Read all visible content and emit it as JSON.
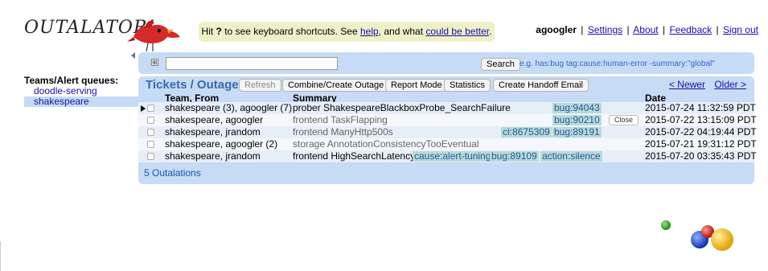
{
  "app": {
    "logo_text": "OUTALATOR!",
    "hint": {
      "prefix": "Hit ",
      "key": "?",
      "middle": " to see keyboard shortcuts. See ",
      "help_link": "help",
      "and": ", and what ",
      "better_link": "could be better",
      "suffix": "."
    }
  },
  "userbar": {
    "username": "agoogler",
    "links": [
      "Settings",
      "About",
      "Feedback",
      "Sign out"
    ]
  },
  "sidebar": {
    "title": "Teams/Alert queues:",
    "items": [
      {
        "label": "doodle-serving",
        "selected": false
      },
      {
        "label": "shakespeare",
        "selected": true
      }
    ]
  },
  "search": {
    "expand_symbol": "⊞",
    "value": "",
    "button_label": "Search",
    "example": "e.g. has:bug tag:cause:human-error -summary:\"global\""
  },
  "tickets": {
    "title": "Tickets / Outages",
    "buttons": {
      "refresh": "Refresh",
      "combine": "Combine/Create Outage",
      "report": "Report Mode",
      "statistics": "Statistics",
      "handoff": "Create Handoff Email"
    },
    "pager": {
      "newer": "< Newer",
      "older": "Older >"
    },
    "columns": {
      "team": "Team, From",
      "summary": "Summary",
      "date": "Date"
    },
    "rows": [
      {
        "team": "shakespeare (3), agoogler (7)",
        "summary": "prober ShakespeareBlackboxProbe_SearchFailure",
        "muted": false,
        "tags": [
          {
            "text": "bug:94043"
          }
        ],
        "close": "",
        "date": "2015-07-24 11:32:59 PDT",
        "cursor": true
      },
      {
        "team": "shakespeare, agoogler",
        "summary": "frontend TaskFlapping",
        "muted": true,
        "tags": [
          {
            "text": "bug:90210"
          }
        ],
        "close": "Close",
        "date": "2015-07-22 13:15:09 PDT",
        "cursor": false
      },
      {
        "team": "shakespeare, jrandom",
        "summary": "frontend ManyHttp500s",
        "muted": true,
        "tags": [
          {
            "text": "cl:8675309"
          },
          {
            "text": "bug:89191"
          }
        ],
        "close": "",
        "date": "2015-07-22 04:19:44 PDT",
        "cursor": false
      },
      {
        "team": "shakespeare, agoogler (2)",
        "summary": "storage AnnotationConsistencyTooEventual",
        "muted": true,
        "tags": [],
        "close": "",
        "date": "2015-07-21 19:31:12 PDT",
        "cursor": false
      },
      {
        "team": "shakespeare, jrandom",
        "summary": "frontend HighSearchLatency",
        "muted": false,
        "tags": [
          {
            "text": "cause:alert-tuning"
          },
          {
            "text": "bug:89109"
          },
          {
            "text": "action:silence"
          }
        ],
        "close": "",
        "date": "2015-07-20 03:35:43 PDT",
        "cursor": false
      }
    ],
    "count_label": "5 Outalations"
  },
  "colors": {
    "panel": "#c6dbf5",
    "hint_bg": "#f0f0c8",
    "tag_bg": "#b7dbd7",
    "link": "#1a0dab",
    "title": "#3a6ab0"
  }
}
